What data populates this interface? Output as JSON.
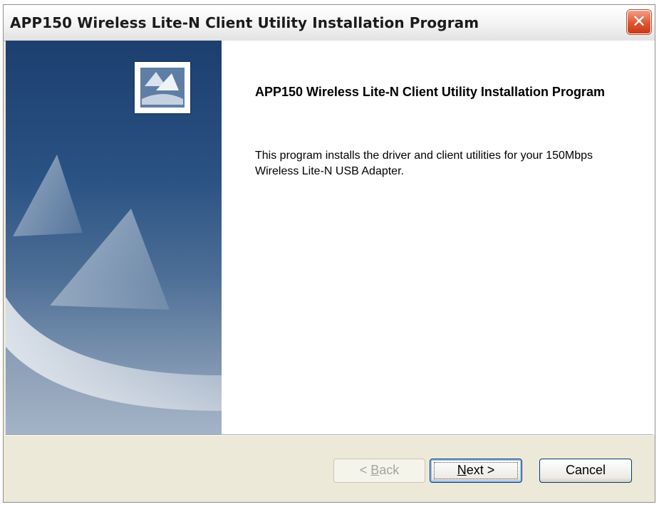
{
  "window": {
    "title": "APP150 Wireless Lite-N Client Utility Installation Program",
    "close_symbol": "✕"
  },
  "sidebar": {
    "logo_icon": "installer-logo-icon"
  },
  "content": {
    "heading": "APP150 Wireless Lite-N Client Utility Installation Program",
    "description": "This program installs the driver and client utilities for your 150Mbps Wireless Lite-N USB Adapter."
  },
  "buttons": {
    "back": {
      "mnemonic": "B",
      "rest": "ack",
      "prefix": "< ",
      "enabled": false
    },
    "next": {
      "mnemonic": "N",
      "rest": "ext >",
      "prefix": ""
    },
    "cancel": {
      "label": "Cancel"
    }
  },
  "colors": {
    "panel_blue": "#1c3f6f",
    "close_red": "#e0542f",
    "dialog_gray": "#ece9d8"
  }
}
